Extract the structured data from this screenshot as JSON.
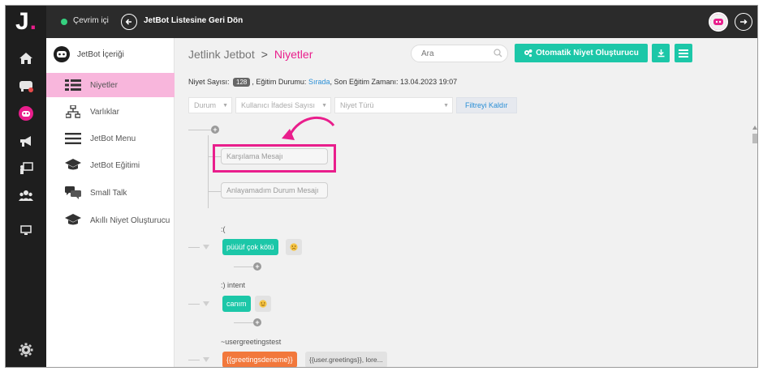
{
  "rail": {
    "logo_letter": "J",
    "logo_dot": ".",
    "icons": [
      "home-icon",
      "chat-icon",
      "bot-face-icon",
      "megaphone-icon",
      "presentation-icon",
      "users-icon",
      "monitor-icon",
      "gear-icon"
    ]
  },
  "topbar": {
    "status": "Çevrim içi",
    "back_label": "JetBot Listesine Geri Dön"
  },
  "sidebar": {
    "header": "JetBot İçeriği",
    "items": [
      {
        "label": "Niyetler",
        "icon": "list-icon",
        "active": true
      },
      {
        "label": "Varlıklar",
        "icon": "hierarchy-icon",
        "active": false
      },
      {
        "label": "JetBot Menu",
        "icon": "menu-icon",
        "active": false
      },
      {
        "label": "JetBot Eğitimi",
        "icon": "graduation-cap-icon",
        "active": false
      },
      {
        "label": "Small Talk",
        "icon": "chat-bubbles-icon",
        "active": false
      },
      {
        "label": "Akıllı Niyet Oluşturucu",
        "icon": "graduation-cap-icon",
        "active": false
      }
    ]
  },
  "main": {
    "breadcrumb": {
      "root": "Jetlink Jetbot",
      "separator": ">",
      "current": "Niyetler"
    },
    "search_placeholder": "Ara",
    "auto_button": "Otomatik Niyet Oluşturucu",
    "info": {
      "count_label": "Niyet Sayısı:",
      "count": "128",
      "training_label": "Eğitim Durumu:",
      "training_status": "Sırada",
      "last_training_label": "Son Eğitim Zamanı:",
      "last_training": "13.04.2023 19:07"
    },
    "filters": {
      "status": "Durum",
      "user_expr_count": "Kullanıcı İfadesi Sayısı",
      "intent_type": "Niyet Türü",
      "clear": "Filtreyi Kaldır"
    },
    "tree": {
      "welcome": "Karşılama Mesajı",
      "fallback": "Anlayamadım Durum Mesajı",
      "groups": [
        {
          "label": ":(",
          "intent": "püüüf çok kötü"
        },
        {
          "label": ":) intent",
          "intent": "canım"
        },
        {
          "label": "~usergreetingstest",
          "intent": "{{greetingsdeneme}}",
          "response": "{{user.greetings}}, lore..."
        }
      ]
    }
  },
  "colors": {
    "accent": "#e91e8c",
    "teal": "#1cc7a8",
    "orange": "#f2783c",
    "dark": "#1e1e1e"
  }
}
